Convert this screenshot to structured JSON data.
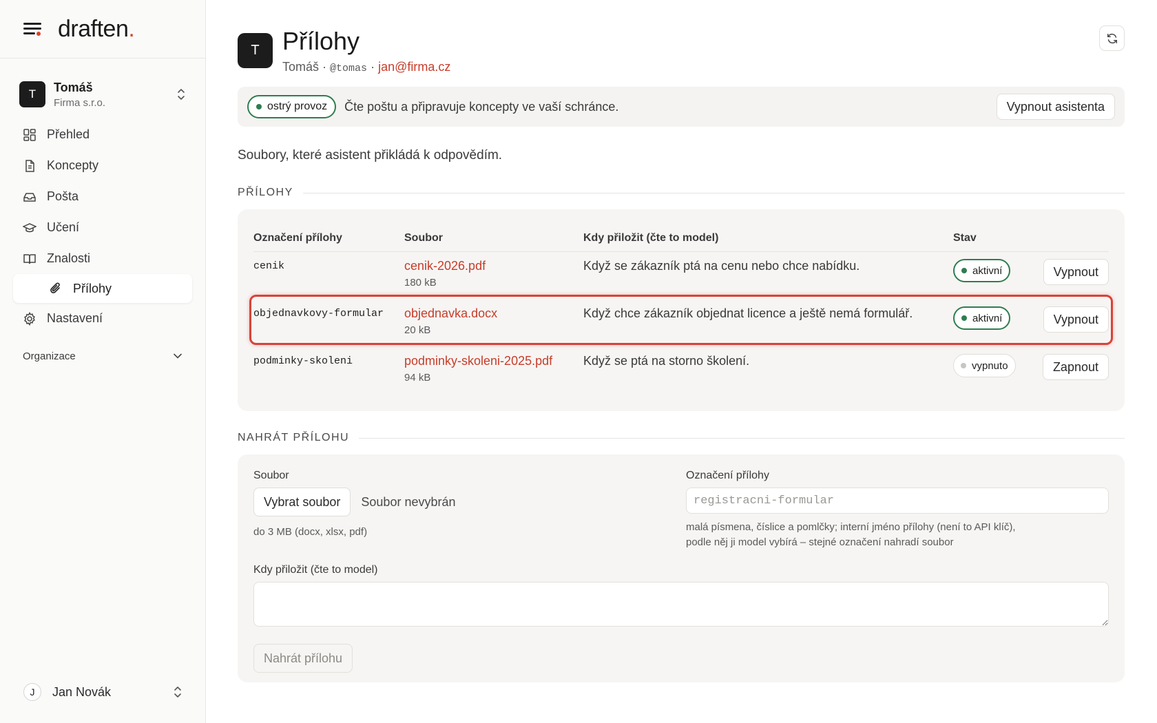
{
  "app": {
    "logo_text": "draften",
    "logo_dot": "."
  },
  "sidebar": {
    "account": {
      "avatar": "T",
      "name": "Tomáš",
      "org": "Firma s.r.o."
    },
    "items": [
      {
        "label": "Přehled",
        "icon": "grid-icon"
      },
      {
        "label": "Koncepty",
        "icon": "document-icon"
      },
      {
        "label": "Pošta",
        "icon": "inbox-icon"
      },
      {
        "label": "Učení",
        "icon": "graduation-cap-icon"
      },
      {
        "label": "Znalosti",
        "icon": "book-icon"
      },
      {
        "label": "Přílohy",
        "icon": "paperclip-icon",
        "active": true
      },
      {
        "label": "Nastavení",
        "icon": "gear-icon"
      }
    ],
    "org_section": "Organizace",
    "user": {
      "avatar": "J",
      "name": "Jan Novák"
    }
  },
  "header": {
    "avatar": "T",
    "title": "Přílohy",
    "name": "Tomáš",
    "sep1": "·",
    "handle": "@tomas",
    "sep2": "·",
    "email": "jan@firma.cz"
  },
  "status": {
    "badge": "ostrý provoz",
    "text": "Čte poštu a připravuje koncepty ve vaší schránce.",
    "button": "Vypnout asistenta"
  },
  "intro": "Soubory, které asistent přikládá k odpovědím.",
  "attachments": {
    "section_title": "PŘÍLOHY",
    "columns": {
      "label": "Označení přílohy",
      "file": "Soubor",
      "when": "Kdy přiložit (čte to model)",
      "state": "Stav"
    },
    "rows": [
      {
        "label": "cenik",
        "file": "cenik-2026.pdf",
        "size": "180 kB",
        "when": "Když se zákazník ptá na cenu nebo chce nabídku.",
        "state": "aktivní",
        "action": "Vypnout"
      },
      {
        "label": "objednavkovy-formular",
        "file": "objednavka.docx",
        "size": "20 kB",
        "when": "Když chce zákazník objednat licence a ještě nemá formulář.",
        "state": "aktivní",
        "action": "Vypnout"
      },
      {
        "label": "podminky-skoleni",
        "file": "podminky-skoleni-2025.pdf",
        "size": "94 kB",
        "when": "Když se ptá na storno školení.",
        "state": "vypnuto",
        "action": "Zapnout"
      }
    ]
  },
  "upload": {
    "section_title": "NAHRÁT PŘÍLOHU",
    "file_label": "Soubor",
    "pick_button": "Vybrat soubor",
    "no_file": "Soubor nevybrán",
    "file_hint": "do 3 MB (docx, xlsx, pdf)",
    "label_label": "Označení přílohy",
    "label_placeholder": "registracni-formular",
    "label_hint_1": "malá písmena, číslice a pomlčky; interní jméno přílohy (není to API klíč),",
    "label_hint_2": "podle něj ji model vybírá – stejné označení nahradí soubor",
    "when_label": "Kdy přiložit (čte to model)",
    "when_value": "",
    "submit": "Nahrát přílohu"
  },
  "colors": {
    "accent": "#c73d2a",
    "active": "#2e7d4f",
    "highlight": "#d8433a"
  }
}
